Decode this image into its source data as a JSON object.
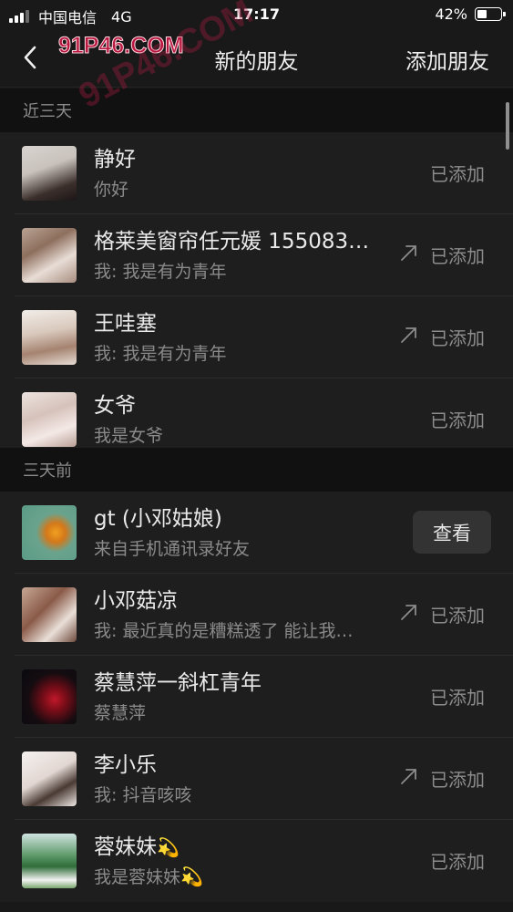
{
  "status_bar": {
    "carrier": "中国电信",
    "network": "4G",
    "time": "17:17",
    "battery_percent": "42%",
    "battery_level": 0.42
  },
  "nav": {
    "watermark": "91P46.COM",
    "title": "新的朋友",
    "action_label": "添加朋友"
  },
  "sections": [
    {
      "header": "近三天",
      "rows": [
        {
          "name": "静好",
          "subtitle": "你好",
          "status": "已添加",
          "arrow": false
        },
        {
          "name": "格莱美窗帘任元媛 155083…",
          "subtitle": "我: 我是有为青年",
          "status": "已添加",
          "arrow": true
        },
        {
          "name": "王哇塞",
          "subtitle": "我: 我是有为青年",
          "status": "已添加",
          "arrow": true
        },
        {
          "name": "女爷",
          "subtitle": "我是女爷",
          "status": "已添加",
          "arrow": false
        }
      ]
    },
    {
      "header": "三天前",
      "rows": [
        {
          "name": "gt (小邓姑娘)",
          "subtitle": "来自手机通讯录好友",
          "status": "查看",
          "button": true
        },
        {
          "name": "小邓菇凉",
          "subtitle": "我: 最近真的是糟糕透了  能让我…",
          "status": "已添加",
          "arrow": true
        },
        {
          "name": "蔡慧萍一斜杠青年",
          "subtitle": "蔡慧萍",
          "status": "已添加",
          "arrow": false
        },
        {
          "name": "李小乐",
          "subtitle": "我: 抖音咳咳",
          "status": "已添加",
          "arrow": true
        },
        {
          "name": "蓉妹妹",
          "name_emoji": "💫",
          "subtitle": "我是蓉妹妹",
          "subtitle_emoji": "💫",
          "status": "已添加",
          "arrow": false
        }
      ]
    }
  ],
  "colors": {
    "background": "#191919",
    "row_background": "#1e1e1e",
    "section_background": "#111111",
    "button_background": "#333333",
    "secondary_text": "#8a8a8a",
    "watermark": "#b8183f"
  }
}
